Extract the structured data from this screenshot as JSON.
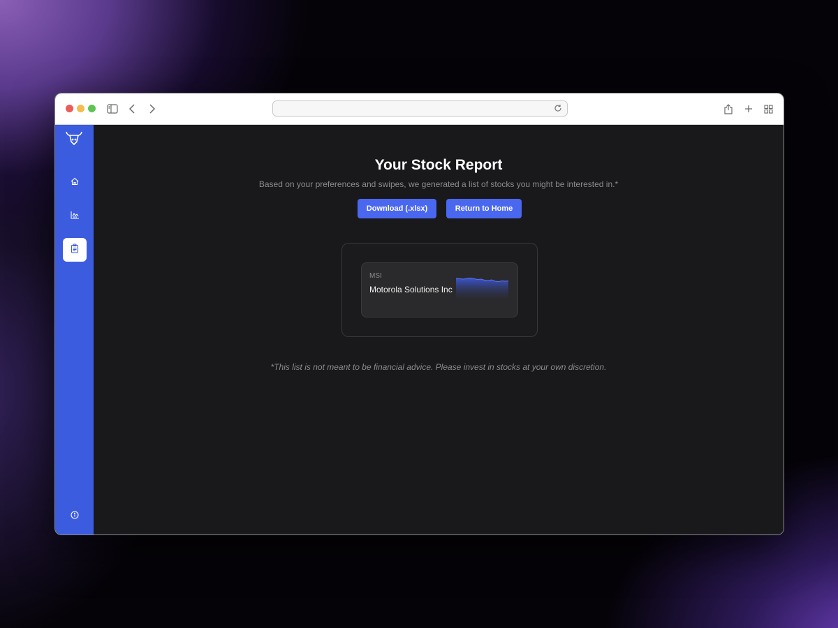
{
  "browser": {
    "url": ""
  },
  "sidebar": {
    "items": [
      {
        "name": "home",
        "icon": "home-icon",
        "active": false
      },
      {
        "name": "charts",
        "icon": "chart-icon",
        "active": false
      },
      {
        "name": "report",
        "icon": "clipboard-icon",
        "active": true
      }
    ],
    "footer_icon": "info-icon",
    "logo_icon": "bull-logo-icon"
  },
  "report": {
    "title": "Your Stock Report",
    "subtitle": "Based on your preferences and swipes, we generated a list of stocks you might be interested in.*",
    "download_label": "Download (.xlsx)",
    "home_label": "Return to Home",
    "disclaimer": "*This list is not meant to be financial advice. Please invest in stocks at your own discretion."
  },
  "stocks": [
    {
      "ticker": "MSI",
      "name": "Motorola Solutions Inc"
    }
  ],
  "colors": {
    "accent": "#4a67f0",
    "sidebar": "#3c5ce0",
    "background": "#19191b"
  }
}
